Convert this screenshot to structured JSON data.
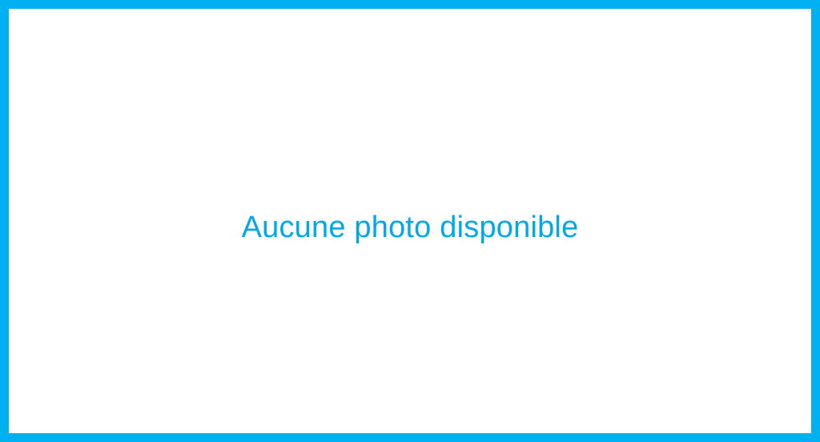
{
  "placeholder": {
    "message": "Aucune photo disponible"
  },
  "colors": {
    "border": "#00b1f2",
    "text": "#00a8e8",
    "background": "#ffffff"
  }
}
